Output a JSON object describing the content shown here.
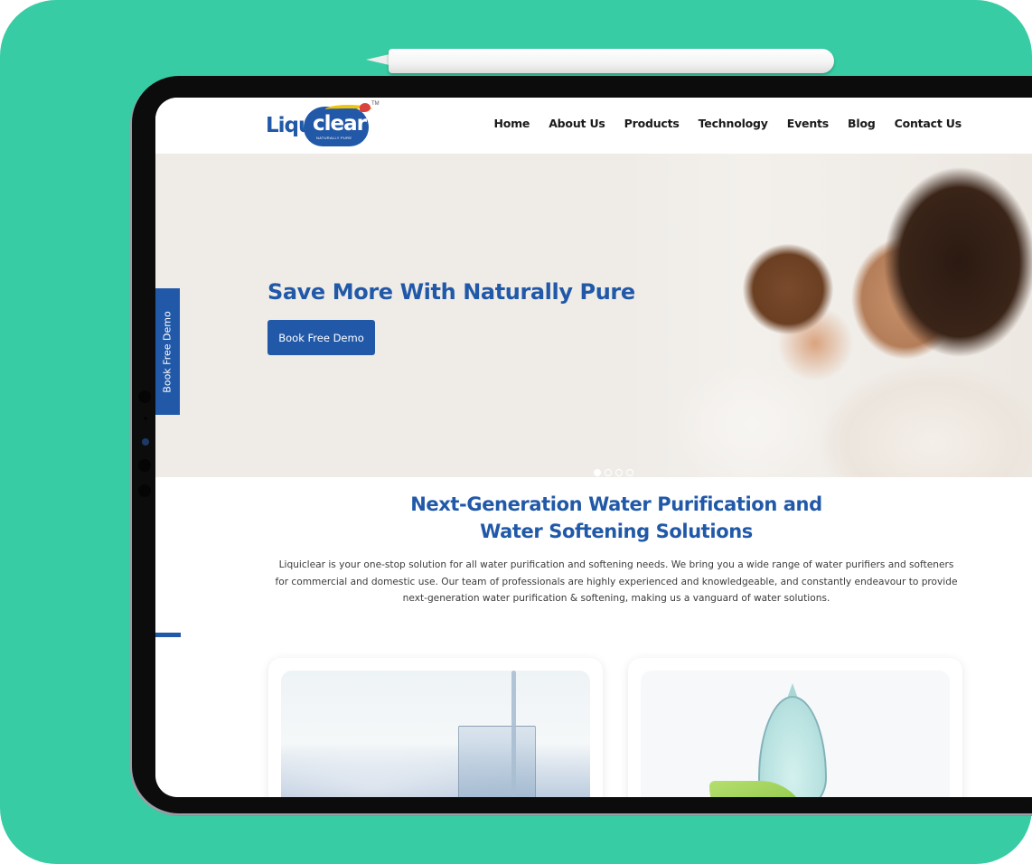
{
  "colors": {
    "background": "#38cca4",
    "brand_blue": "#2159a8",
    "tablet_bezel": "#0c0c0c",
    "hero_bg": "#efece8"
  },
  "header": {
    "logo": {
      "text_left": "Li",
      "text_mid": "qui",
      "text_word": "clear",
      "tagline": "NATURALLY PURE",
      "trademark": "TM",
      "full_name": "Liquiclear"
    },
    "nav": [
      {
        "label": "Home"
      },
      {
        "label": "About Us"
      },
      {
        "label": "Products"
      },
      {
        "label": "Technology"
      },
      {
        "label": "Events"
      },
      {
        "label": "Blog"
      },
      {
        "label": "Contact Us"
      }
    ]
  },
  "hero": {
    "title": "Save More With Naturally Pure",
    "cta_label": "Book Free Demo",
    "side_tab_label": "Book Free Demo",
    "image_alt": "mother-and-baby-photo",
    "slides": {
      "count": 4,
      "active_index": 0
    }
  },
  "intro": {
    "title_line1": "Next-Generation Water Purification and",
    "title_line2": "Water Softening Solutions",
    "body": "Liquiclear is your one-stop solution for all water purification and softening needs. We bring you a wide range of water purifiers and softeners for commercial and domestic use. Our team of professionals are highly experienced and knowledgeable, and constantly endeavour to provide next-generation water purification & softening, making us a vanguard of water solutions."
  },
  "cards": [
    {
      "image_alt": "glass-of-water-clouds-image"
    },
    {
      "image_alt": "water-drop-leaf-image"
    }
  ]
}
